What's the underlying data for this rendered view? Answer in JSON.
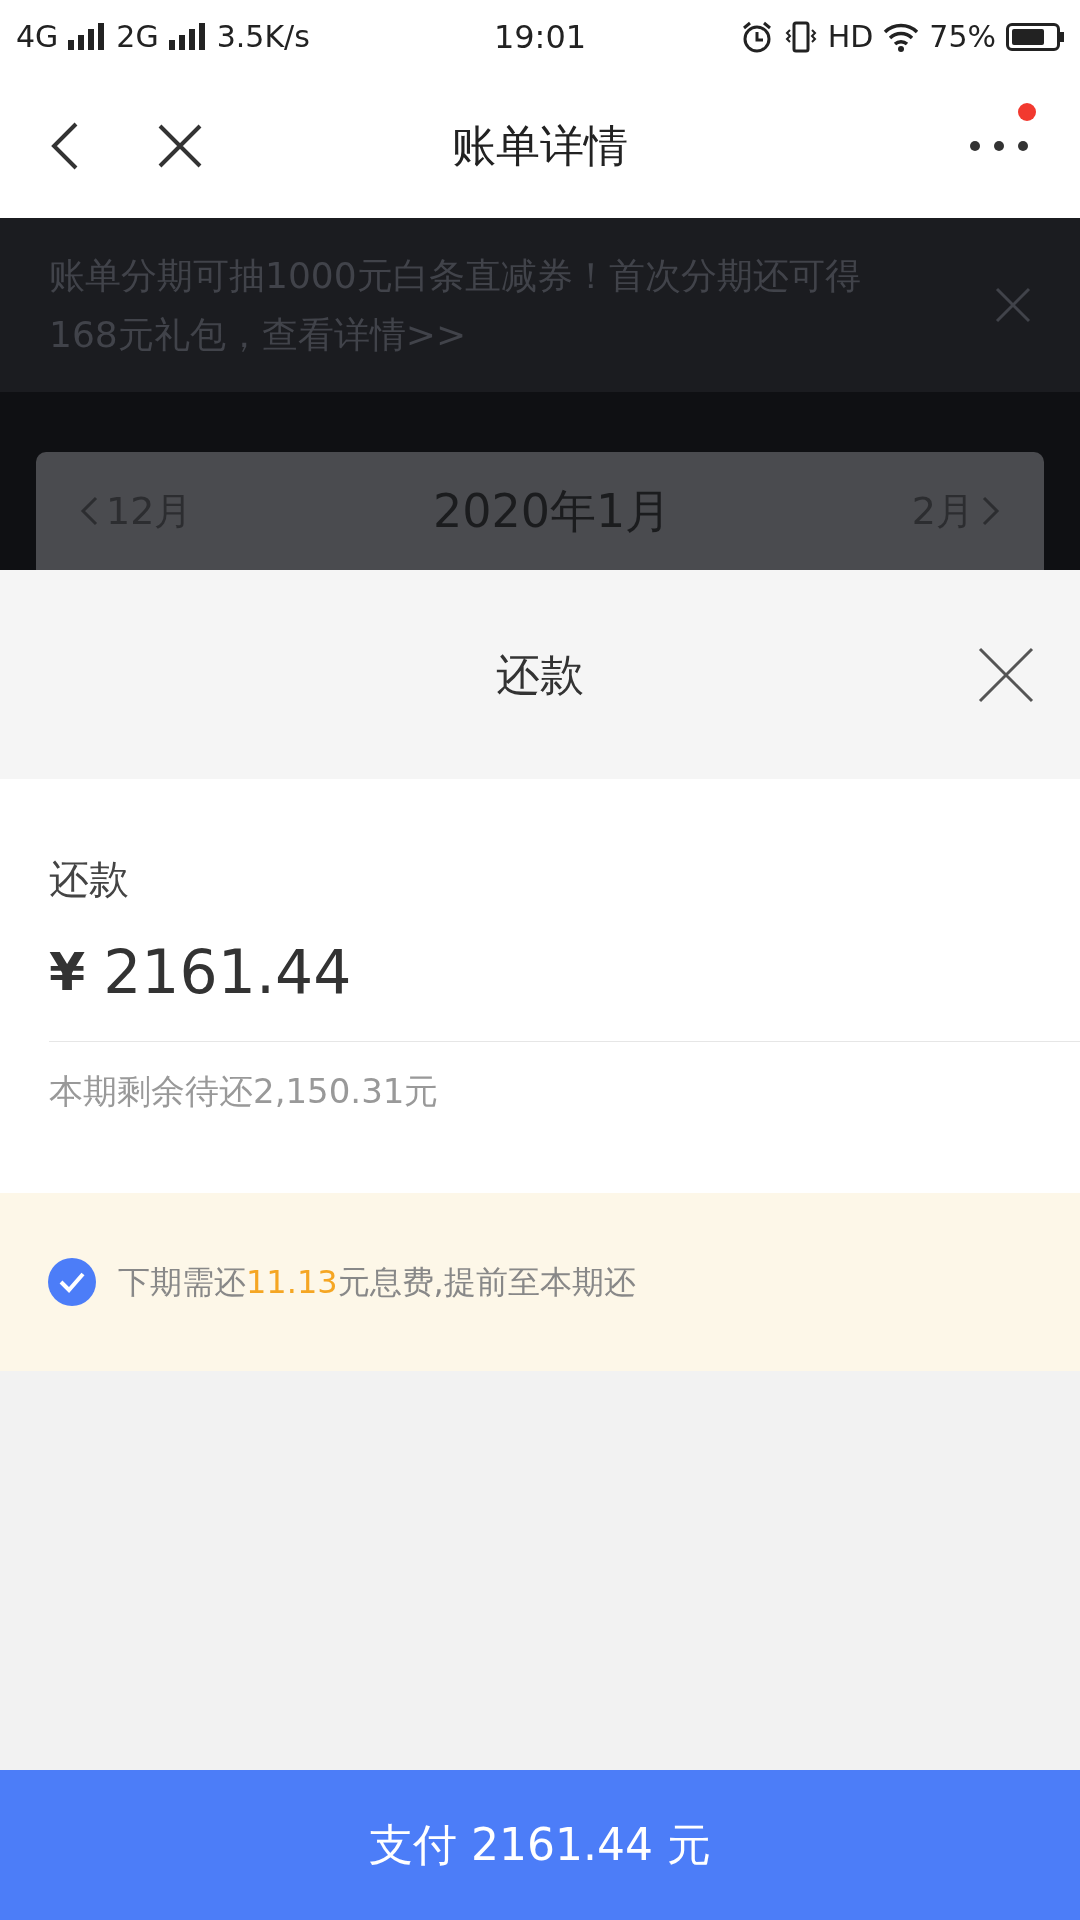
{
  "status_bar": {
    "network_1": "4G",
    "network_2": "2G",
    "speed": "3.5K/s",
    "time": "19:01",
    "hd": "HD",
    "battery": "75%"
  },
  "nav": {
    "title": "账单详情",
    "has_notification": true
  },
  "banner": {
    "text": "账单分期可抽1000元白条直减券！首次分期还可得168元礼包，查看详情>>"
  },
  "month_card": {
    "prev": "12月",
    "current": "2020年1月",
    "next": "2月"
  },
  "sheet": {
    "title": "还款",
    "label": "还款",
    "currency": "¥",
    "amount": "2161.44",
    "remaining": "本期剩余待还2,150.31元",
    "option": {
      "checked": true,
      "parts": [
        {
          "text": "下期需还",
          "highlight": false
        },
        {
          "text": "11.13",
          "highlight": true
        },
        {
          "text": "元息费,提前至本期还",
          "highlight": false
        }
      ]
    }
  },
  "pay_button": "支付 2161.44 元"
}
